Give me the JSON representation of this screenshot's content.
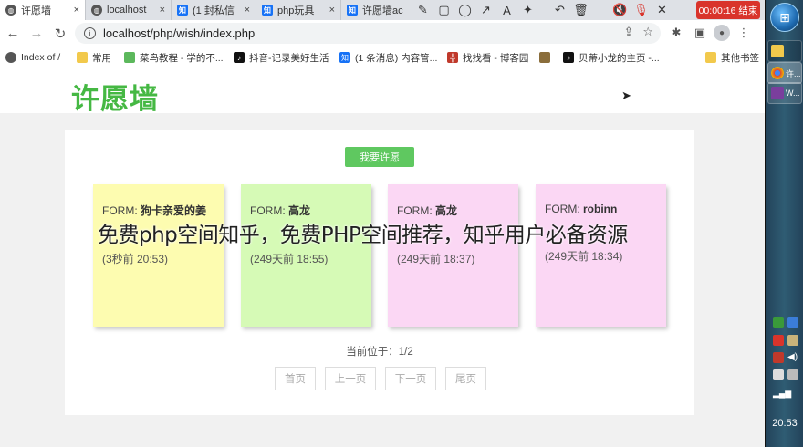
{
  "browser": {
    "tabs": [
      {
        "label": "许愿墙",
        "icon": "globe-icon"
      },
      {
        "label": "localhost",
        "icon": "globe-icon"
      },
      {
        "label": "(1 封私信",
        "icon": "zhihu-icon"
      },
      {
        "label": "php玩具",
        "icon": "zhihu-icon"
      },
      {
        "label": "许愿墙ac",
        "icon": "zhihu-icon"
      }
    ],
    "tab_close": "×",
    "recording": "00:00:16 结束",
    "url": "localhost/php/wish/index.php",
    "bookmarks": [
      {
        "label": "Index of /",
        "color": "#555555"
      },
      {
        "label": "常用",
        "color": "#f2c94c"
      },
      {
        "label": "菜鸟教程 - 学的不...",
        "color": "#5cb85c"
      },
      {
        "label": "抖音-记录美好生活",
        "color": "#111111"
      },
      {
        "label": "(1 条消息) 内容管...",
        "color": "#1772f6"
      },
      {
        "label": "找找看 - 博客园",
        "color": "#c0392b"
      },
      {
        "label": "",
        "color": "#8a6d3b"
      },
      {
        "label": "贝蒂小龙的主页 -...",
        "color": "#111111"
      },
      {
        "label": "其他书签",
        "color": "#f2c94c"
      }
    ]
  },
  "page": {
    "site_title": "许愿墙",
    "wish_button": "我要许愿",
    "cards": [
      {
        "from_label": "FORM:",
        "name": "狗卡亲爱的姜",
        "time": "(3秒前 20:53)",
        "color": "#fdfcb0"
      },
      {
        "from_label": "FORM:",
        "name": "高龙",
        "time": "(249天前 18:55)",
        "color": "#d6fab6"
      },
      {
        "from_label": "FORM:",
        "name": "高龙",
        "time": "(249天前 18:37)",
        "color": "#fbd7f4"
      },
      {
        "from_label": "FORM:",
        "name": "robinn",
        "time": "(249天前 18:34)",
        "color": "#fbd7f4"
      }
    ],
    "page_info": "当前位于：1/2",
    "pager": [
      "首页",
      "上一页",
      "下一页",
      "尾页"
    ]
  },
  "watermark": "免费php空间知乎，免费PHP空间推荐，知乎用户必备资源",
  "taskbar": {
    "items": [
      "许...",
      "W..."
    ],
    "clock": "20:53"
  }
}
